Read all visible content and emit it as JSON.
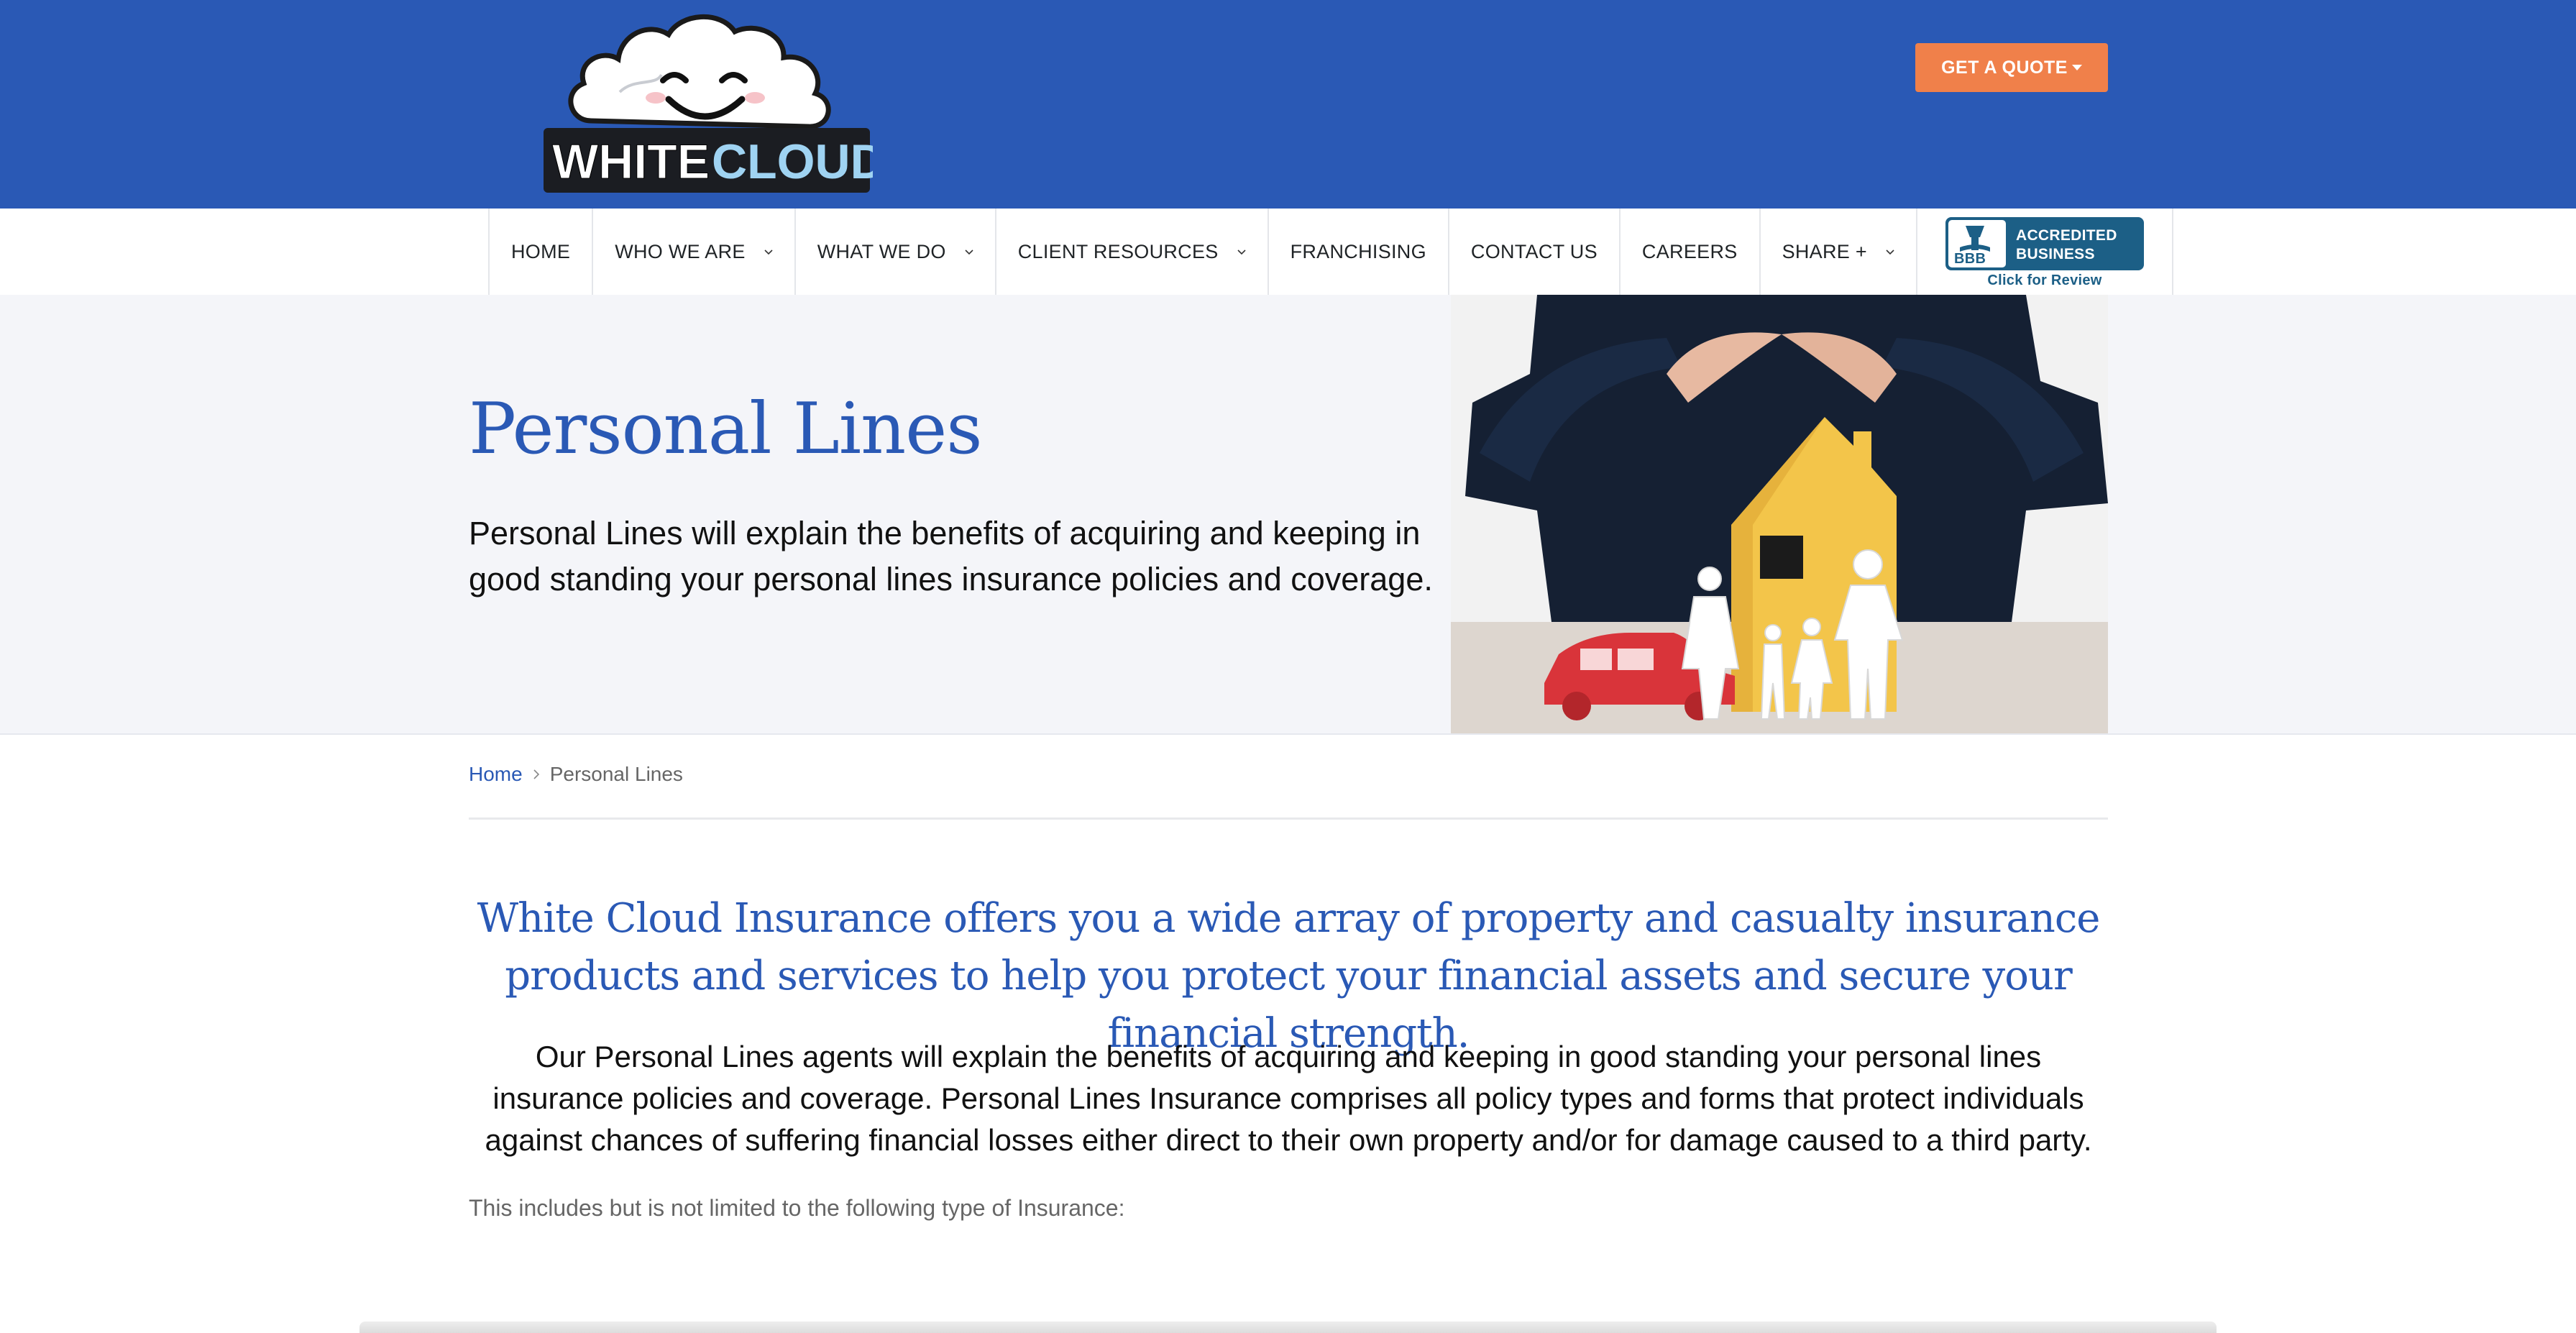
{
  "brand": {
    "logo_text_white": "WHITE",
    "logo_text_blue": "CLOUD"
  },
  "header": {
    "quote_button": "GET A QUOTE"
  },
  "nav": {
    "items": [
      {
        "label": "HOME",
        "dropdown": false
      },
      {
        "label": "WHO WE ARE",
        "dropdown": true
      },
      {
        "label": "WHAT WE DO",
        "dropdown": true
      },
      {
        "label": "CLIENT RESOURCES",
        "dropdown": true
      },
      {
        "label": "FRANCHISING",
        "dropdown": false
      },
      {
        "label": "CONTACT US",
        "dropdown": false
      },
      {
        "label": "CAREERS",
        "dropdown": false
      },
      {
        "label": "SHARE +",
        "dropdown": true
      }
    ],
    "bbb": {
      "line1": "ACCREDITED",
      "line2": "BUSINESS",
      "mark": "BBB",
      "caption": "Click for Review"
    }
  },
  "hero": {
    "title": "Personal Lines",
    "text": "Personal Lines will explain the benefits of acquiring and keeping in good standing your personal lines insurance policies and coverage."
  },
  "breadcrumb": {
    "home": "Home",
    "current": "Personal Lines"
  },
  "main": {
    "lead": "White Cloud Insurance offers you a wide array of property and casualty insurance products and services to help you protect your financial assets and secure your financial strength.",
    "body": "Our Personal Lines agents will explain the benefits of acquiring and keeping in good standing your personal lines insurance policies and coverage. Personal Lines Insurance comprises all policy types and forms that protect individuals against chances of suffering financial losses either direct to their own property and/or for damage caused to a third party.",
    "note": "This includes but is not limited to the following type of Insurance:"
  },
  "colors": {
    "brand_blue": "#2a59b5",
    "accent_orange": "#f0804a",
    "hero_bg": "#f4f5f9"
  },
  "icons": [
    "cloud-logo-icon",
    "caret-down-icon",
    "chevron-down-icon",
    "chevron-right-icon",
    "bbb-torch-icon"
  ]
}
